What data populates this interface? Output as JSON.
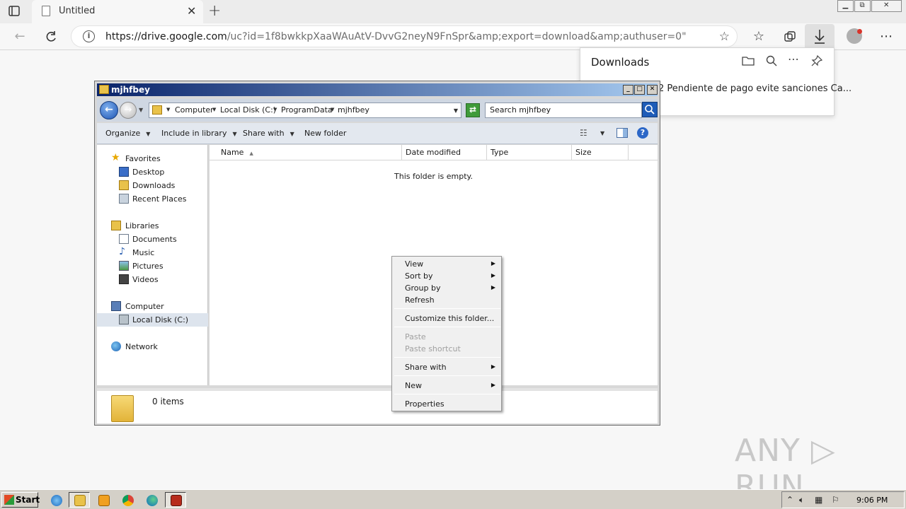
{
  "browser": {
    "tab_title": "Untitled",
    "tab_close": "✕",
    "new_tab": "+",
    "url_host": "https://drive.google.com",
    "url_path": "/uc?id=1f8bwkkpXaaWAuAtV-DvvG2neyN9FnSpr&amp;export=download&amp;authuser=0\"",
    "window_buttons": [
      "▭",
      "⧉",
      "✕"
    ]
  },
  "downloads": {
    "title": "Downloads",
    "item_text": "2 Pendiente de pago evite sanciones Ca..."
  },
  "explorer": {
    "window_title": "mjhfbey",
    "breadcrumb": [
      "Computer",
      "Local Disk (C:)",
      "ProgramData",
      "mjhfbey"
    ],
    "search_placeholder": "Search mjhfbey",
    "commands": [
      "Organize",
      "Include in library",
      "Share with",
      "New folder"
    ],
    "nav": {
      "favorites": "Favorites",
      "desktop": "Desktop",
      "downloads": "Downloads",
      "recent": "Recent Places",
      "libraries": "Libraries",
      "documents": "Documents",
      "music": "Music",
      "pictures": "Pictures",
      "videos": "Videos",
      "computer": "Computer",
      "local_disk": "Local Disk (C:)",
      "network": "Network"
    },
    "columns": [
      "Name",
      "Date modified",
      "Type",
      "Size"
    ],
    "empty_message": "This folder is empty.",
    "item_count": "0 items"
  },
  "context_menu": {
    "view": "View",
    "sort_by": "Sort by",
    "group_by": "Group by",
    "refresh": "Refresh",
    "customize": "Customize this folder...",
    "paste": "Paste",
    "paste_shortcut": "Paste shortcut",
    "share_with": "Share with",
    "new": "New",
    "properties": "Properties"
  },
  "watermark": "ANY ▷ RUN",
  "taskbar": {
    "start": "Start",
    "clock": "9:06 PM"
  },
  "colors": {
    "explorer_title_start": "#0a246a",
    "explorer_title_end": "#a6caf0",
    "selected_nav": "#dde4ed"
  }
}
